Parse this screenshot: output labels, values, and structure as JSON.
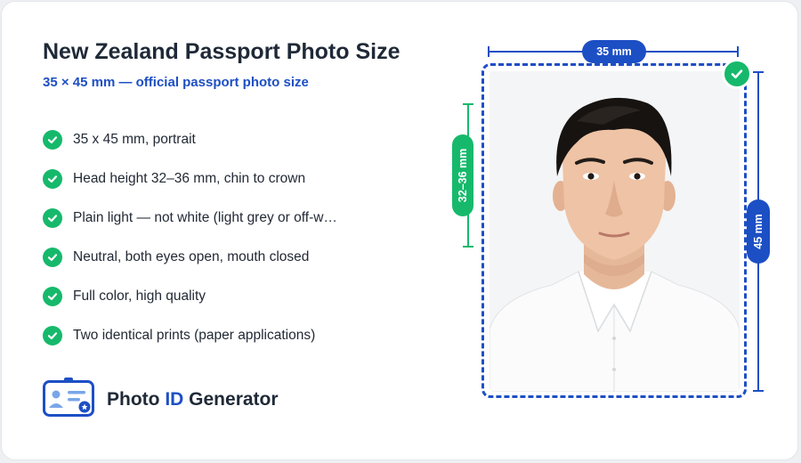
{
  "title": "New Zealand Passport Photo Size",
  "subtitle": "35 × 45 mm — official passport photo size",
  "requirements": [
    "35 x 45 mm, portrait",
    "Head height 32–36 mm, chin to crown",
    "Plain light — not white (light grey or off-w…",
    "Neutral, both eyes open, mouth closed",
    "Full color, high quality",
    "Two identical prints (paper applications)"
  ],
  "brand": {
    "part1": "Photo",
    "part2": "ID",
    "part3": "Generator"
  },
  "dimensions": {
    "width": "35 mm",
    "height": "45 mm",
    "head": "32–36 mm"
  },
  "colors": {
    "accent_blue": "#1d4fc4",
    "check_green": "#16b96b"
  },
  "icons": [
    "check-circle-icon",
    "id-card-icon",
    "portrait-photo"
  ]
}
